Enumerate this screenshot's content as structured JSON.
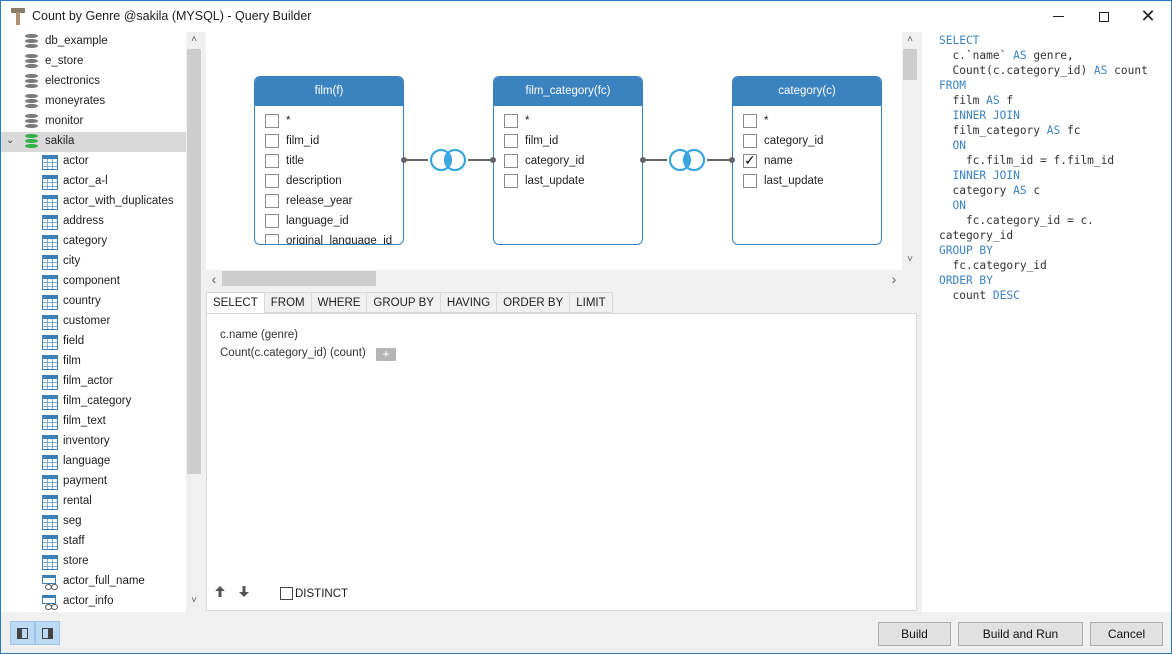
{
  "window": {
    "title": "Count by Genre @sakila (MYSQL) - Query Builder",
    "controls": {
      "minimize": "minimize",
      "maximize": "maximize",
      "close": "✕"
    }
  },
  "tree": {
    "databases": [
      {
        "label": "db_example",
        "icon": "database-icon"
      },
      {
        "label": "e_store",
        "icon": "database-icon"
      },
      {
        "label": "electronics",
        "icon": "database-icon"
      },
      {
        "label": "moneyrates",
        "icon": "database-icon"
      },
      {
        "label": "monitor",
        "icon": "database-icon"
      },
      {
        "label": "sakila",
        "icon": "database-icon",
        "expanded": true,
        "selected": true
      }
    ],
    "expand_glyph": "⌄",
    "tables": [
      "actor",
      "actor_a-l",
      "actor_with_duplicates",
      "address",
      "category",
      "city",
      "component",
      "country",
      "customer",
      "field",
      "film",
      "film_actor",
      "film_category",
      "film_text",
      "inventory",
      "language",
      "payment",
      "rental",
      "seg",
      "staff",
      "store"
    ],
    "views": [
      "actor_full_name",
      "actor_info"
    ]
  },
  "diagram": {
    "tables": [
      {
        "title": "film(f)",
        "fields": [
          {
            "name": "*",
            "checked": false
          },
          {
            "name": "film_id",
            "checked": false
          },
          {
            "name": "title",
            "checked": false
          },
          {
            "name": "description",
            "checked": false
          },
          {
            "name": "release_year",
            "checked": false
          },
          {
            "name": "language_id",
            "checked": false
          },
          {
            "name": "original_language_id",
            "checked": false
          }
        ]
      },
      {
        "title": "film_category(fc)",
        "fields": [
          {
            "name": "*",
            "checked": false
          },
          {
            "name": "film_id",
            "checked": false
          },
          {
            "name": "category_id",
            "checked": false
          },
          {
            "name": "last_update",
            "checked": false
          }
        ]
      },
      {
        "title": "category(c)",
        "fields": [
          {
            "name": "*",
            "checked": false
          },
          {
            "name": "category_id",
            "checked": false
          },
          {
            "name": "name",
            "checked": true
          },
          {
            "name": "last_update",
            "checked": false
          }
        ]
      }
    ],
    "joins": [
      "inner-join",
      "inner-join"
    ]
  },
  "scroll": {
    "up": "˄",
    "down": "˅",
    "left": "‹",
    "right": "›"
  },
  "clauses": {
    "tabs": [
      "SELECT",
      "FROM",
      "WHERE",
      "GROUP BY",
      "HAVING",
      "ORDER BY",
      "LIMIT"
    ],
    "active_tab": "SELECT",
    "select_items": [
      "c.name  (genre)",
      "Count(c.category_id)  (count)"
    ],
    "add_label": "+",
    "move_up": "🡅",
    "move_down": "🡇",
    "distinct_label": "DISTINCT",
    "distinct_checked": false
  },
  "sql": [
    [
      {
        "t": "SELECT",
        "k": true
      }
    ],
    [
      {
        "t": "  c.`name` ",
        "k": false
      },
      {
        "t": "AS",
        "k": true
      },
      {
        "t": " genre,",
        "k": false
      }
    ],
    [
      {
        "t": "  Count(c.category_id) ",
        "k": false
      },
      {
        "t": "AS",
        "k": true
      },
      {
        "t": " count",
        "k": false
      }
    ],
    [
      {
        "t": "FROM",
        "k": true
      }
    ],
    [
      {
        "t": "  film ",
        "k": false
      },
      {
        "t": "AS",
        "k": true
      },
      {
        "t": " f",
        "k": false
      }
    ],
    [
      {
        "t": "  INNER JOIN",
        "k": true
      }
    ],
    [
      {
        "t": "  film_category ",
        "k": false
      },
      {
        "t": "AS",
        "k": true
      },
      {
        "t": " fc",
        "k": false
      }
    ],
    [
      {
        "t": "  ON",
        "k": true
      }
    ],
    [
      {
        "t": "    fc.film_id = f.film_id",
        "k": false
      }
    ],
    [
      {
        "t": "  INNER JOIN",
        "k": true
      }
    ],
    [
      {
        "t": "  category ",
        "k": false
      },
      {
        "t": "AS",
        "k": true
      },
      {
        "t": " c",
        "k": false
      }
    ],
    [
      {
        "t": "  ON",
        "k": true
      }
    ],
    [
      {
        "t": "    fc.category_id = c.",
        "k": false
      }
    ],
    [
      {
        "t": "category_id",
        "k": false
      }
    ],
    [
      {
        "t": "GROUP BY",
        "k": true
      }
    ],
    [
      {
        "t": "  fc.category_id",
        "k": false
      }
    ],
    [
      {
        "t": "ORDER BY",
        "k": true
      }
    ],
    [
      {
        "t": "  count ",
        "k": false
      },
      {
        "t": "DESC",
        "k": true
      }
    ]
  ],
  "footer": {
    "build": "Build",
    "build_and_run": "Build and Run",
    "cancel": "Cancel"
  },
  "colors": {
    "accent": "#3b82c0",
    "join": "#3aa6df",
    "sakila_db": "#34b04a"
  }
}
